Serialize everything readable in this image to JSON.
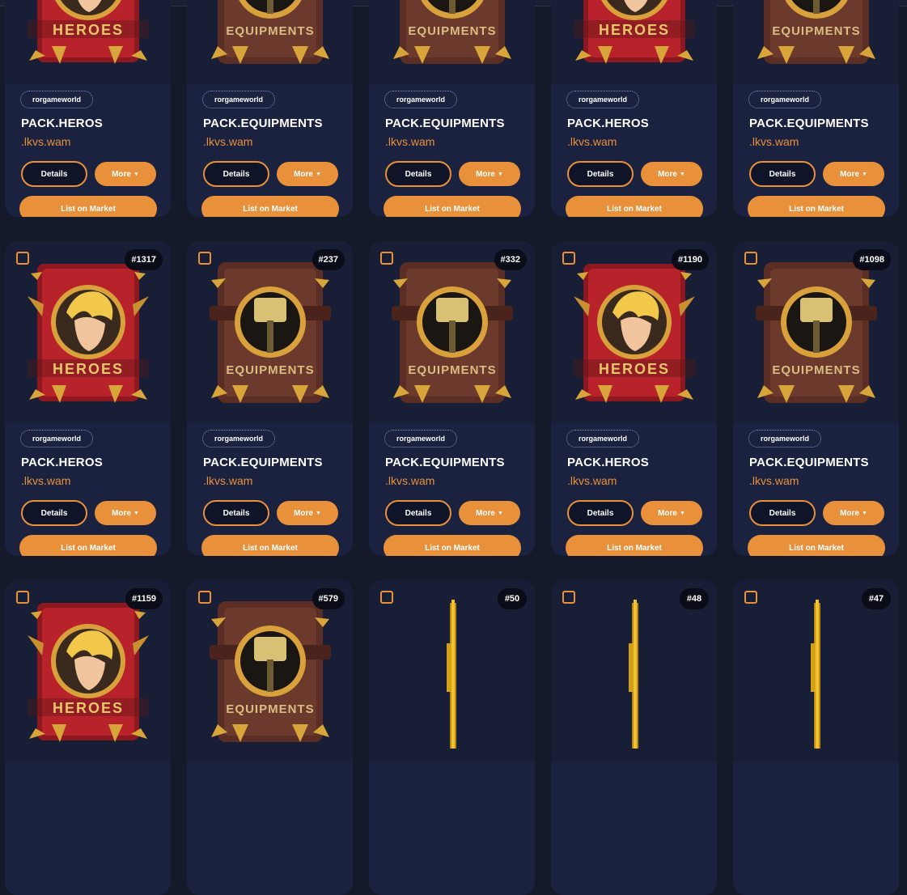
{
  "colors": {
    "background": "#151a2b",
    "card": "#1b2240",
    "accent": "#e8913a",
    "badge": "#0a0d18"
  },
  "labels": {
    "details": "Details",
    "more": "More",
    "list": "List on Market"
  },
  "cards": [
    {
      "id": "",
      "art": "heroes",
      "collection": "rorgameworld",
      "name": "PACK.HEROS",
      "creator": ".lkvs.wam"
    },
    {
      "id": "",
      "art": "equipments",
      "collection": "rorgameworld",
      "name": "PACK.EQUIPMENTS",
      "creator": ".lkvs.wam"
    },
    {
      "id": "",
      "art": "equipments",
      "collection": "rorgameworld",
      "name": "PACK.EQUIPMENTS",
      "creator": ".lkvs.wam"
    },
    {
      "id": "",
      "art": "heroes",
      "collection": "rorgameworld",
      "name": "PACK.HEROS",
      "creator": ".lkvs.wam"
    },
    {
      "id": "",
      "art": "equipments",
      "collection": "rorgameworld",
      "name": "PACK.EQUIPMENTS",
      "creator": ".lkvs.wam"
    },
    {
      "id": "#1317",
      "art": "heroes",
      "collection": "rorgameworld",
      "name": "PACK.HEROS",
      "creator": ".lkvs.wam"
    },
    {
      "id": "#237",
      "art": "equipments",
      "collection": "rorgameworld",
      "name": "PACK.EQUIPMENTS",
      "creator": ".lkvs.wam"
    },
    {
      "id": "#332",
      "art": "equipments",
      "collection": "rorgameworld",
      "name": "PACK.EQUIPMENTS",
      "creator": ".lkvs.wam"
    },
    {
      "id": "#1190",
      "art": "heroes",
      "collection": "rorgameworld",
      "name": "PACK.HEROS",
      "creator": ".lkvs.wam"
    },
    {
      "id": "#1098",
      "art": "equipments",
      "collection": "rorgameworld",
      "name": "PACK.EQUIPMENTS",
      "creator": ".lkvs.wam"
    },
    {
      "id": "#1159",
      "art": "heroes",
      "collection": "",
      "name": "",
      "creator": ""
    },
    {
      "id": "#579",
      "art": "equipments",
      "collection": "",
      "name": "",
      "creator": ""
    },
    {
      "id": "#50",
      "art": "scroll",
      "collection": "",
      "name": "",
      "creator": ""
    },
    {
      "id": "#48",
      "art": "scroll",
      "collection": "",
      "name": "",
      "creator": ""
    },
    {
      "id": "#47",
      "art": "scroll",
      "collection": "",
      "name": "",
      "creator": ""
    }
  ]
}
